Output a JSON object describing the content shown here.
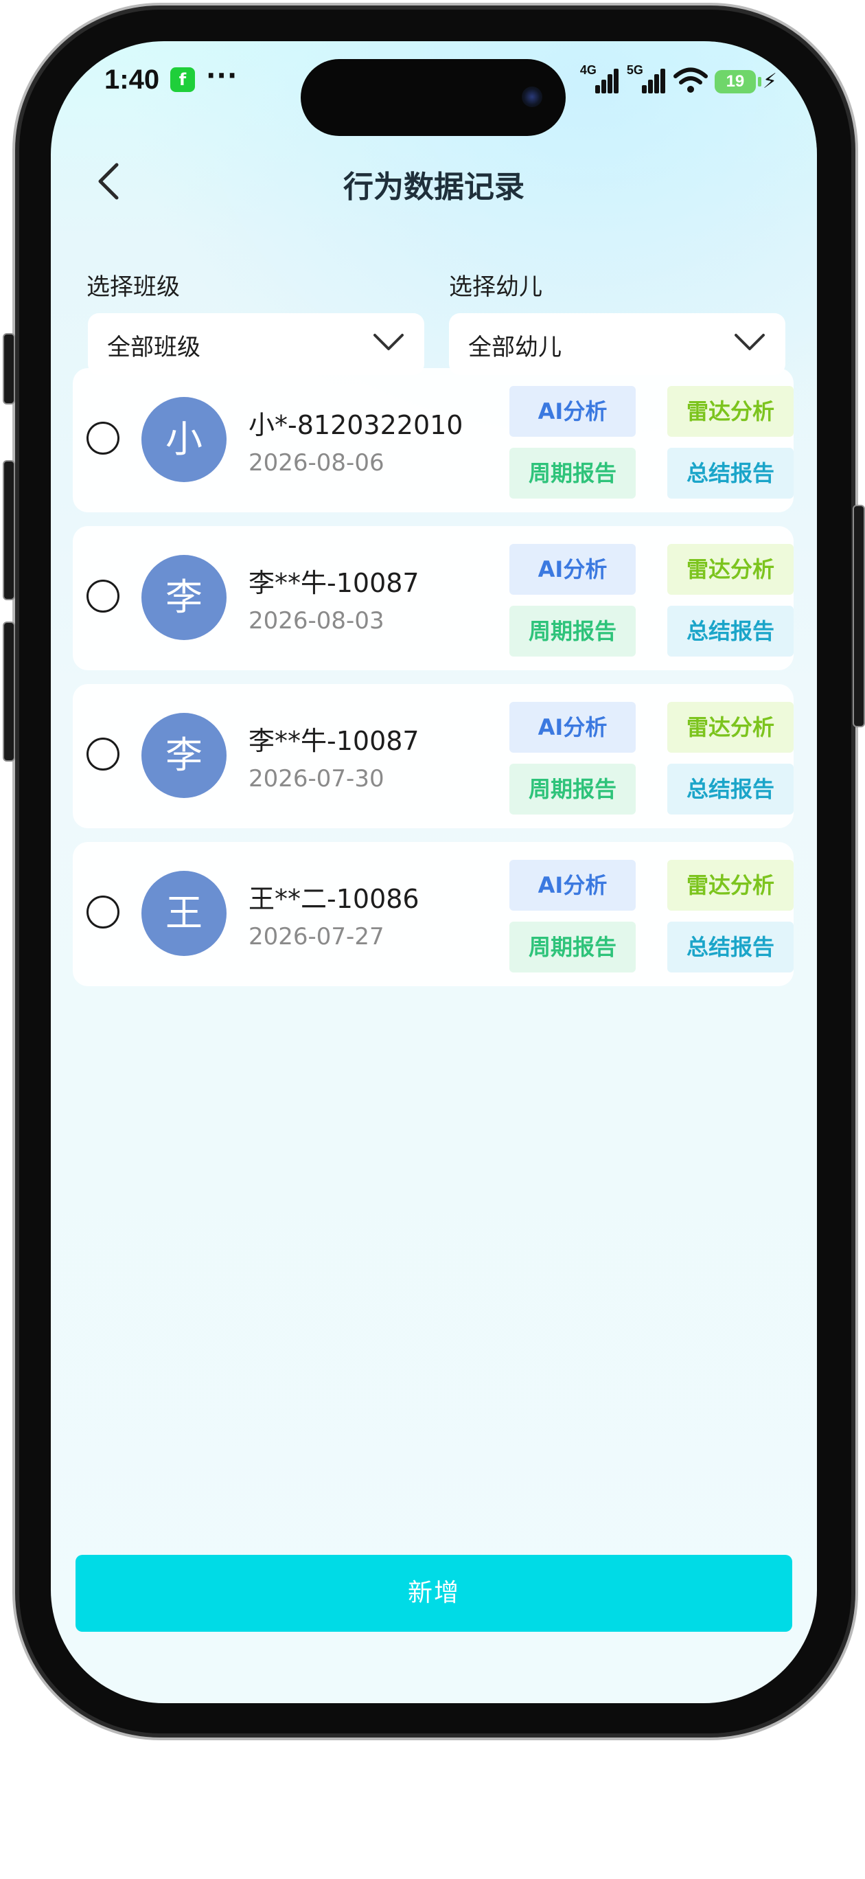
{
  "status_bar": {
    "time": "1:40",
    "app_badge": "f",
    "more": "···",
    "net1": "4G",
    "net2": "5G",
    "battery": "19",
    "bolt": "⚡"
  },
  "nav": {
    "title": "行为数据记录"
  },
  "filters": {
    "class_label": "选择班级",
    "class_value": "全部班级",
    "child_label": "选择幼儿",
    "child_value": "全部幼儿"
  },
  "records": [
    {
      "avatar": "小",
      "name": "小*-8120322010",
      "date": "2026-08-06"
    },
    {
      "avatar": "李",
      "name": "李**牛-10087",
      "date": "2026-08-03"
    },
    {
      "avatar": "李",
      "name": "李**牛-10087",
      "date": "2026-07-30"
    },
    {
      "avatar": "王",
      "name": "王**二-10086",
      "date": "2026-07-27"
    }
  ],
  "actions": {
    "ai": "AI分析",
    "radar": "雷达分析",
    "period": "周期报告",
    "summary": "总结报告"
  },
  "footer": {
    "add_label": "新增"
  },
  "colors": {
    "primary": "#00dbe6",
    "avatar": "#6a8fd1",
    "ai": "#3b79e0",
    "radar": "#7cc41e",
    "period": "#2ec37a",
    "summary": "#1ba5c9"
  }
}
